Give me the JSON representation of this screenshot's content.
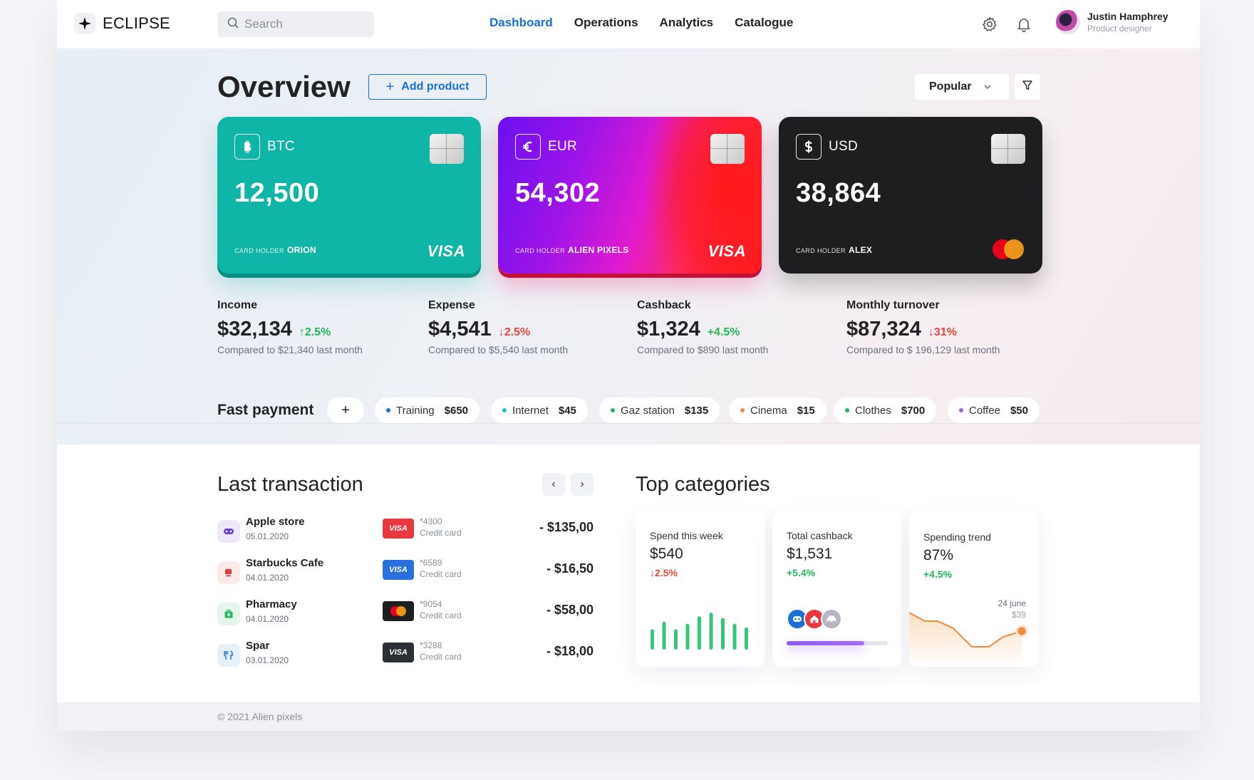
{
  "brand": {
    "name": "ECLIPSE"
  },
  "search": {
    "placeholder": "Search"
  },
  "nav": {
    "items": [
      "Dashboard",
      "Operations",
      "Analytics",
      "Catalogue"
    ],
    "active": "Dashboard"
  },
  "user": {
    "name": "Justin Hamphrey",
    "role": "Product designer"
  },
  "overview": {
    "title": "Overview",
    "add_product_label": "Add product",
    "sort_value": "Popular"
  },
  "cards": [
    {
      "currency": "BTC",
      "amount": "12,500",
      "holder_label": "CARD HOLDER",
      "holder": "ORION",
      "network": "VISA"
    },
    {
      "currency": "EUR",
      "amount": "54,302",
      "holder_label": "CARD HOLDER",
      "holder": "ALIEN PIXELS",
      "network": "VISA"
    },
    {
      "currency": "USD",
      "amount": "38,864",
      "holder_label": "CARD HOLDER",
      "holder": "ALEX",
      "network": "mastercard"
    }
  ],
  "stats": [
    {
      "label": "Income",
      "value": "$32,134",
      "change": "2.5%",
      "direction": "up",
      "compare": "Compared to $21,340 last month"
    },
    {
      "label": "Expense",
      "value": "$4,541",
      "change": "2.5%",
      "direction": "down",
      "compare": "Compared to $5,540 last month"
    },
    {
      "label": "Cashback",
      "value": "$1,324",
      "change": "+4.5%",
      "direction": "up",
      "compare": "Compared to $890 last month"
    },
    {
      "label": "Monthly turnover",
      "value": "$87,324",
      "change": "31%",
      "direction": "down",
      "compare": "Compared to $ 196,129 last month"
    }
  ],
  "fast_payment": {
    "title": "Fast payment",
    "add_label": "+",
    "items": [
      {
        "name": "Training",
        "amount": "$650",
        "color": "#1a6fd6"
      },
      {
        "name": "Internet",
        "amount": "$45",
        "color": "#19c0c8"
      },
      {
        "name": "Gaz station",
        "amount": "$135",
        "color": "#22b85a"
      },
      {
        "name": "Cinema",
        "amount": "$15",
        "color": "#f08a3c"
      },
      {
        "name": "Clothes",
        "amount": "$700",
        "color": "#22b85a"
      },
      {
        "name": "Coffee",
        "amount": "$50",
        "color": "#9b5de5"
      }
    ]
  },
  "last_transaction": {
    "title": "Last transaction",
    "prev_label": "‹",
    "next_label": "›",
    "rows": [
      {
        "name": "Apple store",
        "date": "05.01.2020",
        "card_logo": "VISA",
        "card_number": "*4300",
        "card_type": "Credit card",
        "amount": "- $135,00",
        "icon": "gamepad-icon"
      },
      {
        "name": "Starbucks Cafe",
        "date": "04.01.2020",
        "card_logo": "VISA",
        "card_number": "*6589",
        "card_type": "Credit card",
        "amount": "- $16,50",
        "icon": "coffee-cup-icon"
      },
      {
        "name": "Pharmacy",
        "date": "04.01.2020",
        "card_logo": "mastercard",
        "card_number": "*9054",
        "card_type": "Credit card",
        "amount": "- $58,00",
        "icon": "medkit-icon"
      },
      {
        "name": "Spar",
        "date": "03.01.2020",
        "card_logo": "VISA",
        "card_number": "*3288",
        "card_type": "Credit card",
        "amount": "- $18,00",
        "icon": "cutlery-icon"
      }
    ]
  },
  "top_categories": {
    "title": "Top categories",
    "cards": [
      {
        "label": "Spend this week",
        "value": "$540",
        "change": "2.5%",
        "direction": "down",
        "bars": [
          0.55,
          0.75,
          0.55,
          0.7,
          0.9,
          1.0,
          0.85,
          0.7,
          0.6
        ]
      },
      {
        "label": "Total cashback",
        "value": "$1,531",
        "change": "+5.4%",
        "direction": "up",
        "progress": 0.77
      },
      {
        "label": "Spending trend",
        "value": "87%",
        "change": "+4.5%",
        "direction": "up",
        "tooltip_date": "24 june",
        "tooltip_value": "$39"
      }
    ]
  },
  "footer": {
    "text": "© 2021 Alien pixels"
  }
}
